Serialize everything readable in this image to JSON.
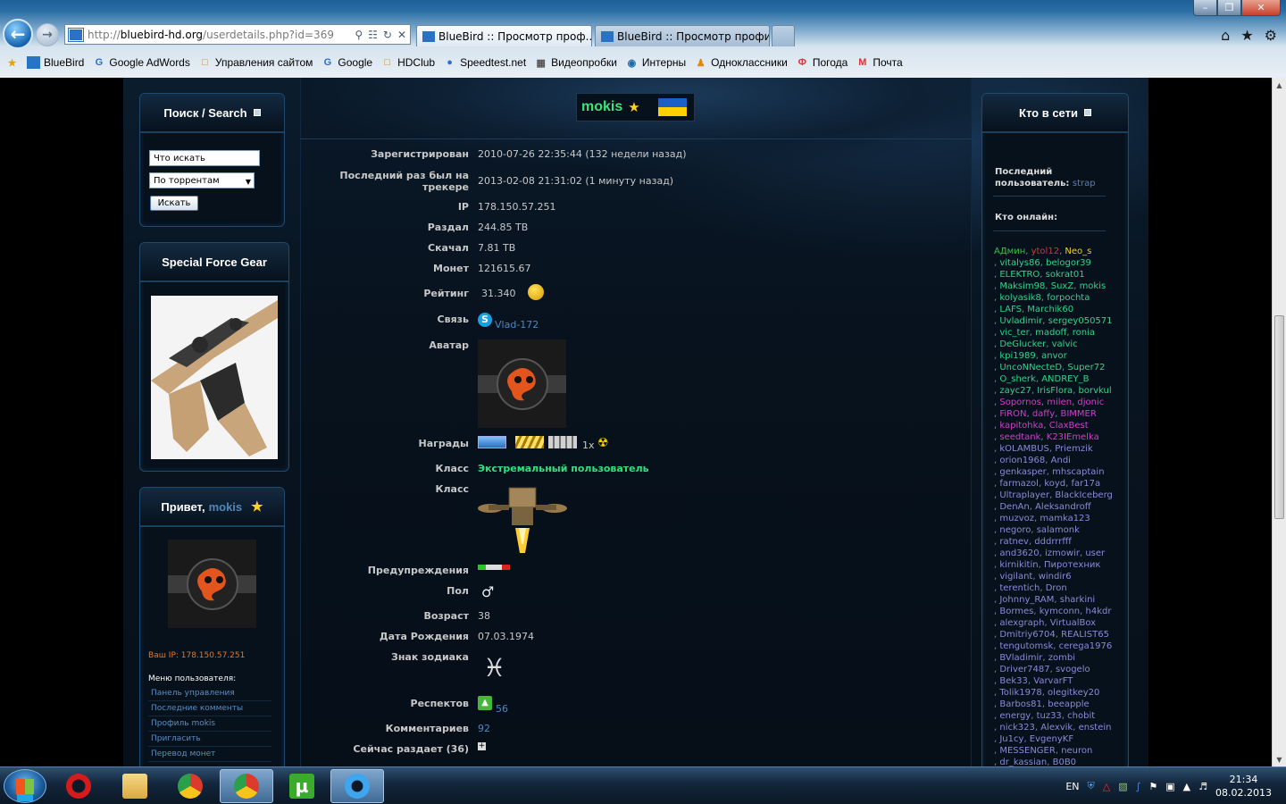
{
  "browser": {
    "url_prefix": "http://",
    "url_host": "bluebird-hd.org",
    "url_path": "/userdetails.php?id=369",
    "tabs": [
      {
        "label": "BlueBird :: Просмотр проф...",
        "active": true
      },
      {
        "label": "BlueBird :: Просмотр профил...",
        "active": false
      }
    ],
    "favorites": [
      {
        "label": "BlueBird",
        "icon": "bluebird-icon"
      },
      {
        "label": "Google AdWords",
        "icon": "google-icon"
      },
      {
        "label": "Управления сайтом",
        "icon": "page-icon"
      },
      {
        "label": "Google",
        "icon": "google-icon"
      },
      {
        "label": "HDClub",
        "icon": "page-icon"
      },
      {
        "label": "Speedtest.net",
        "icon": "speedtest-icon"
      },
      {
        "label": "Видеопробки",
        "icon": "video-icon"
      },
      {
        "label": "Интерны",
        "icon": "globe-icon"
      },
      {
        "label": "Одноклассники",
        "icon": "ok-icon"
      },
      {
        "label": "Погода",
        "icon": "weather-icon"
      },
      {
        "label": "Почта",
        "icon": "mail-icon"
      }
    ]
  },
  "search_block": {
    "title": "Поиск / Search",
    "input_value": "Что искать",
    "select_value": "По торрентам",
    "button": "Искать"
  },
  "gear_block": {
    "title": "Special Force Gear"
  },
  "user_block": {
    "greeting": "Привет, ",
    "username": "mokis",
    "ip_text": "Ваш IP: 178.150.57.251",
    "menu_title": "Меню пользователя:",
    "menu": [
      "Панель управления",
      "Последние комменты",
      "Профиль mokis",
      "Пригласить",
      "Перевод монет"
    ]
  },
  "online_block": {
    "title": "Кто в сети",
    "last_user_label": "Последний пользователь:",
    "last_user": "strap",
    "who_online": "Кто онлайн:",
    "users": [
      {
        "n": "АДмин",
        "c": "#38c24b"
      },
      {
        "n": "ytol12",
        "c": "#e03030"
      },
      {
        "n": "Neo_s",
        "c": "#f0d020"
      },
      {
        "n": "vitalys86",
        "c": "#2fd48c"
      },
      {
        "n": "belogor39",
        "c": "#2fd48c"
      },
      {
        "n": "ELEKTRO",
        "c": "#2fd48c"
      },
      {
        "n": "sokrat01",
        "c": "#2fd48c"
      },
      {
        "n": "Maksim98",
        "c": "#2fd48c"
      },
      {
        "n": "SuxZ",
        "c": "#2fd48c"
      },
      {
        "n": "mokis",
        "c": "#2fd48c"
      },
      {
        "n": "kolyasik8",
        "c": "#2fd48c"
      },
      {
        "n": "forpochta",
        "c": "#2fd48c"
      },
      {
        "n": "LAFS",
        "c": "#2fd48c"
      },
      {
        "n": "Marchik60",
        "c": "#2fd48c"
      },
      {
        "n": "Uvladimir",
        "c": "#2fd48c"
      },
      {
        "n": "sergey050571",
        "c": "#2fd48c"
      },
      {
        "n": "vic_ter",
        "c": "#2fd48c"
      },
      {
        "n": "madoff",
        "c": "#2fd48c"
      },
      {
        "n": "ronia",
        "c": "#2fd48c"
      },
      {
        "n": "DeGlucker",
        "c": "#2fd48c"
      },
      {
        "n": "valvic",
        "c": "#2fd48c"
      },
      {
        "n": "kpi1989",
        "c": "#2fd48c"
      },
      {
        "n": "anvor",
        "c": "#2fd48c"
      },
      {
        "n": "UncoNNecteD",
        "c": "#2fd48c"
      },
      {
        "n": "Super72",
        "c": "#2fd48c"
      },
      {
        "n": "O_sherk",
        "c": "#2fd48c"
      },
      {
        "n": "ANDREY_B",
        "c": "#2fd48c"
      },
      {
        "n": "zayc27",
        "c": "#2fd48c"
      },
      {
        "n": "IrisFlora",
        "c": "#2fd48c"
      },
      {
        "n": "borvkul",
        "c": "#2fd48c"
      },
      {
        "n": "Sopornos",
        "c": "#d03fc8"
      },
      {
        "n": "milen",
        "c": "#d03fc8"
      },
      {
        "n": "djonic",
        "c": "#d03fc8"
      },
      {
        "n": "FiRON",
        "c": "#d03fc8"
      },
      {
        "n": "daffy",
        "c": "#d03fc8"
      },
      {
        "n": "BIMMER",
        "c": "#d03fc8"
      },
      {
        "n": "kapitohka",
        "c": "#d03fc8"
      },
      {
        "n": "ClaxBest",
        "c": "#d03fc8"
      },
      {
        "n": "seedtank",
        "c": "#d03fc8"
      },
      {
        "n": "K23IEmelka",
        "c": "#d03fc8"
      },
      {
        "n": "kOLAMBUS",
        "c": "#8a8ad8"
      },
      {
        "n": "Priemzik",
        "c": "#8a8ad8"
      },
      {
        "n": "orion1968",
        "c": "#8a8ad8"
      },
      {
        "n": "Andi",
        "c": "#8a8ad8"
      },
      {
        "n": "genkasper",
        "c": "#8a8ad8"
      },
      {
        "n": "mhscaptain",
        "c": "#8a8ad8"
      },
      {
        "n": "farmazol",
        "c": "#8a8ad8"
      },
      {
        "n": "koyd",
        "c": "#8a8ad8"
      },
      {
        "n": "far17a",
        "c": "#8a8ad8"
      },
      {
        "n": "Ultraplayer",
        "c": "#8a8ad8"
      },
      {
        "n": "BlackIceberg",
        "c": "#8a8ad8"
      },
      {
        "n": "DenAn",
        "c": "#8a8ad8"
      },
      {
        "n": "Aleksandroff",
        "c": "#8a8ad8"
      },
      {
        "n": "muzvoz",
        "c": "#8a8ad8"
      },
      {
        "n": "mamka123",
        "c": "#8a8ad8"
      },
      {
        "n": "negoro",
        "c": "#8a8ad8"
      },
      {
        "n": "salamonk",
        "c": "#8a8ad8"
      },
      {
        "n": "ratnev",
        "c": "#8a8ad8"
      },
      {
        "n": "dddrrrfff",
        "c": "#8a8ad8"
      },
      {
        "n": "and3620",
        "c": "#8a8ad8"
      },
      {
        "n": "izmowir",
        "c": "#8a8ad8"
      },
      {
        "n": "user",
        "c": "#8a8ad8"
      },
      {
        "n": "kirnikitin",
        "c": "#8a8ad8"
      },
      {
        "n": "Пиротехник",
        "c": "#8a8ad8"
      },
      {
        "n": "vigilant",
        "c": "#8a8ad8"
      },
      {
        "n": "windir6",
        "c": "#8a8ad8"
      },
      {
        "n": "terentich",
        "c": "#8a8ad8"
      },
      {
        "n": "Dron",
        "c": "#8a8ad8"
      },
      {
        "n": "Johnny_RAM",
        "c": "#8a8ad8"
      },
      {
        "n": "sharkini",
        "c": "#8a8ad8"
      },
      {
        "n": "Bormes",
        "c": "#8a8ad8"
      },
      {
        "n": "kymconn",
        "c": "#8a8ad8"
      },
      {
        "n": "h4kdr",
        "c": "#8a8ad8"
      },
      {
        "n": "alexgraph",
        "c": "#8a8ad8"
      },
      {
        "n": "VirtualBox",
        "c": "#8a8ad8"
      },
      {
        "n": "Dmitriy6704",
        "c": "#8a8ad8"
      },
      {
        "n": "REALIST65",
        "c": "#8a8ad8"
      },
      {
        "n": "tengutomsk",
        "c": "#8a8ad8"
      },
      {
        "n": "cerega1976",
        "c": "#8a8ad8"
      },
      {
        "n": "BVladimir",
        "c": "#8a8ad8"
      },
      {
        "n": "zombi",
        "c": "#8a8ad8"
      },
      {
        "n": "Driver7487",
        "c": "#8a8ad8"
      },
      {
        "n": "svogelo",
        "c": "#8a8ad8"
      },
      {
        "n": "Bek33",
        "c": "#8a8ad8"
      },
      {
        "n": "VarvarFT",
        "c": "#8a8ad8"
      },
      {
        "n": "Tolik1978",
        "c": "#8a8ad8"
      },
      {
        "n": "olegitkey20",
        "c": "#8a8ad8"
      },
      {
        "n": "Barbos81",
        "c": "#8a8ad8"
      },
      {
        "n": "beeapple",
        "c": "#8a8ad8"
      },
      {
        "n": "energy",
        "c": "#8a8ad8"
      },
      {
        "n": "tuz33",
        "c": "#8a8ad8"
      },
      {
        "n": "chobit",
        "c": "#8a8ad8"
      },
      {
        "n": "nick323",
        "c": "#8a8ad8"
      },
      {
        "n": "Alexvik",
        "c": "#8a8ad8"
      },
      {
        "n": "enstein",
        "c": "#8a8ad8"
      },
      {
        "n": "Ju1cy",
        "c": "#8a8ad8"
      },
      {
        "n": "EvgenyKF",
        "c": "#8a8ad8"
      },
      {
        "n": "MESSENGER",
        "c": "#8a8ad8"
      },
      {
        "n": "neuron",
        "c": "#8a8ad8"
      },
      {
        "n": "dr_kassian",
        "c": "#8a8ad8"
      },
      {
        "n": "B0B0",
        "c": "#8a8ad8"
      }
    ]
  },
  "profile": {
    "username": "mokis",
    "rows": {
      "registered": {
        "label": "Зарегистрирован",
        "value": "2010-07-26 22:35:44 (132 недели назад)"
      },
      "last_seen": {
        "label": "Последний раз был на трекере",
        "value": "2013-02-08 21:31:02 (1 минуту назад)"
      },
      "ip": {
        "label": "IP",
        "value": "178.150.57.251"
      },
      "uploaded": {
        "label": "Раздал",
        "value": "244.85 TB"
      },
      "downloaded": {
        "label": "Скачал",
        "value": "7.81 TB"
      },
      "coins": {
        "label": "Монет",
        "value": "121615.67"
      },
      "rating": {
        "label": "Рейтинг",
        "value": "31.340"
      },
      "contact": {
        "label": "Связь",
        "value": "Vlad-172"
      },
      "avatar": {
        "label": "Аватар"
      },
      "awards": {
        "label": "Награды",
        "value": "1x"
      },
      "class_name": {
        "label": "Класс",
        "value": "Экстремальный пользователь"
      },
      "class_icon": {
        "label": "Класс"
      },
      "warnings": {
        "label": "Предупреждения"
      },
      "gender": {
        "label": "Пол"
      },
      "age": {
        "label": "Возраст",
        "value": "38"
      },
      "birthday": {
        "label": "Дата Рождения",
        "value": "07.03.1974"
      },
      "zodiac": {
        "label": "Знак зодиака"
      },
      "respect": {
        "label": "Респектов",
        "value": "56"
      },
      "comments": {
        "label": "Комментариев",
        "value": "92"
      },
      "seeding": {
        "label": "Сейчас раздает (36)"
      }
    }
  },
  "taskbar": {
    "lang": "EN",
    "time": "21:34",
    "date": "08.02.2013"
  }
}
